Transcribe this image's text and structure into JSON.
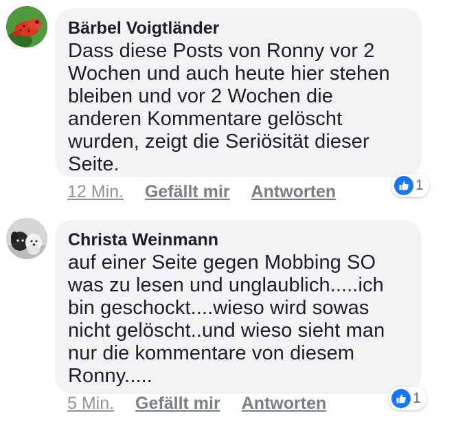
{
  "comments": [
    {
      "author": "Bärbel Voigtländer",
      "text": "Dass diese Posts von Ronny vor 2 Wochen und auch heute hier stehen bleiben und vor 2 Wochen die anderen Kommentare gelöscht wurden, zeigt die Seriösität dieser Seite.",
      "time": "12 Min.",
      "like_label": "Gefällt mir",
      "reply_label": "Antworten",
      "reaction_count": "1",
      "avatar_icon": "red-frog-avatar"
    },
    {
      "author": "Christa Weinmann",
      "text": "auf einer Seite gegen Mobbing SO was zu lesen und unglaublich.....ich bin geschockt....wieso wird sowas nicht gelöscht..und wieso sieht man nur die kommentare von diesem Ronny.....",
      "time": "5 Min.",
      "like_label": "Gefällt mir",
      "reply_label": "Antworten",
      "reaction_count": "1",
      "avatar_icon": "dogs-avatar"
    }
  ],
  "colors": {
    "bubble": "#f2f3f5",
    "like_blue": "#1877f2",
    "meta_gray": "#90949c"
  }
}
